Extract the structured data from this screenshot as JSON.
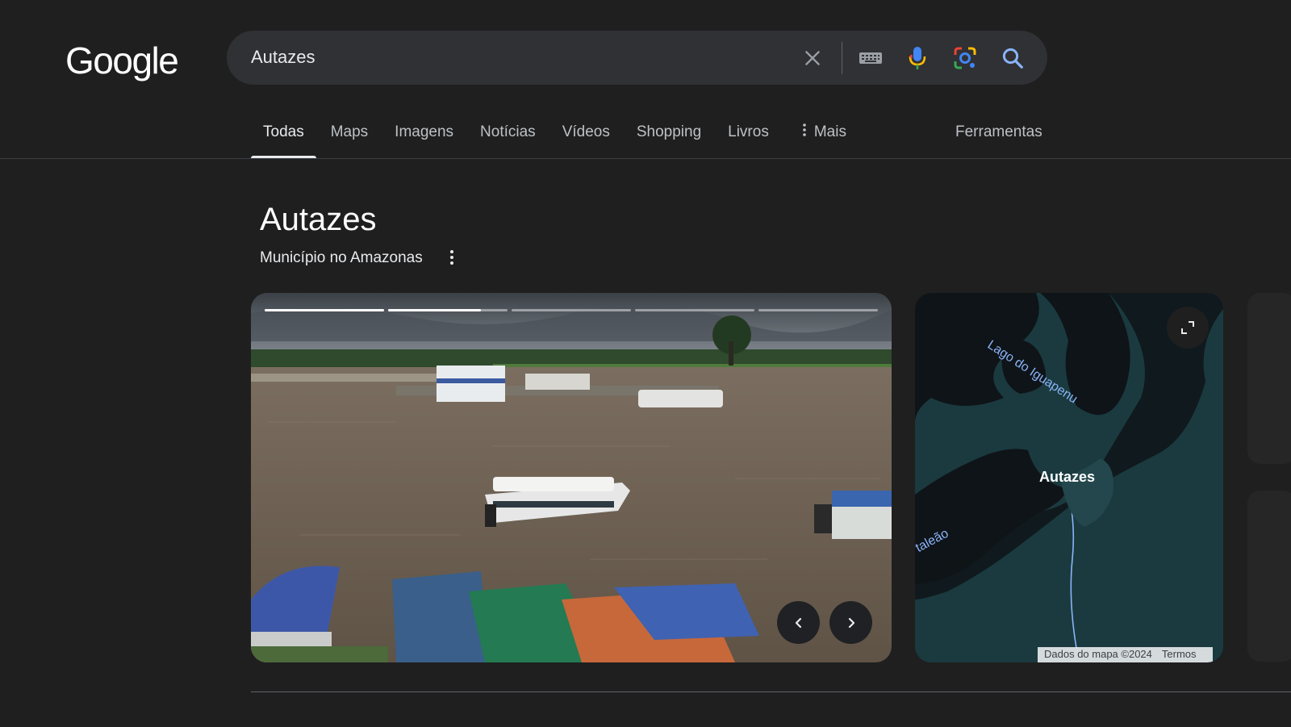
{
  "header": {
    "logo_text": "Google",
    "search_value": "Autazes",
    "icons": [
      "clear-icon",
      "keyboard-icon",
      "microphone-icon",
      "lens-icon",
      "search-icon"
    ]
  },
  "tabs": [
    {
      "label": "Todas",
      "active": true
    },
    {
      "label": "Maps"
    },
    {
      "label": "Imagens"
    },
    {
      "label": "Notícias"
    },
    {
      "label": "Vídeos"
    },
    {
      "label": "Shopping"
    },
    {
      "label": "Livros"
    },
    {
      "label": "Mais"
    }
  ],
  "tools_label": "Ferramentas",
  "knowledge_panel": {
    "title": "Autazes",
    "subtitle": "Município no Amazonas",
    "carousel": {
      "slides": 5,
      "current_slide": 2,
      "current_progress": 0.78
    },
    "map": {
      "labels": {
        "lake": "Lago do Iguapenu",
        "town": "Autazes",
        "river_fragment": "taleão"
      },
      "attribution": "Dados do mapa ©2024",
      "terms": "Termos"
    }
  },
  "colors": {
    "background": "#1f1f1f",
    "searchbar": "#303134",
    "map_water": "#1a3a3f",
    "map_land": "#0f1418",
    "map_label_blue": "#8ab4f8"
  }
}
